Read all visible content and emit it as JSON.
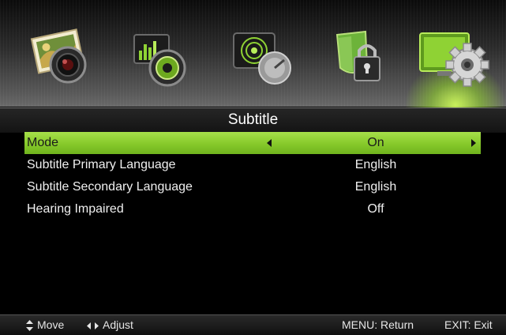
{
  "menu_tabs": [
    {
      "icon": "picture-camera-icon",
      "selected": false
    },
    {
      "icon": "sound-speaker-icon",
      "selected": false
    },
    {
      "icon": "channel-satellite-icon",
      "selected": false
    },
    {
      "icon": "lock-shield-icon",
      "selected": false
    },
    {
      "icon": "setup-gear-icon",
      "selected": true
    }
  ],
  "title": "Subtitle",
  "items": [
    {
      "label": "Mode",
      "value": "On",
      "selected": true
    },
    {
      "label": "Subtitle Primary Language",
      "value": "English",
      "selected": false
    },
    {
      "label": "Subtitle Secondary Language",
      "value": "English",
      "selected": false
    },
    {
      "label": "Hearing Impaired",
      "value": "Off",
      "selected": false
    }
  ],
  "footer": {
    "move": "Move",
    "adjust": "Adjust",
    "return": "MENU: Return",
    "exit": "EXIT: Exit"
  },
  "colors": {
    "highlight": "#8fd234",
    "background": "#000000",
    "text": "#f0f0f0"
  }
}
